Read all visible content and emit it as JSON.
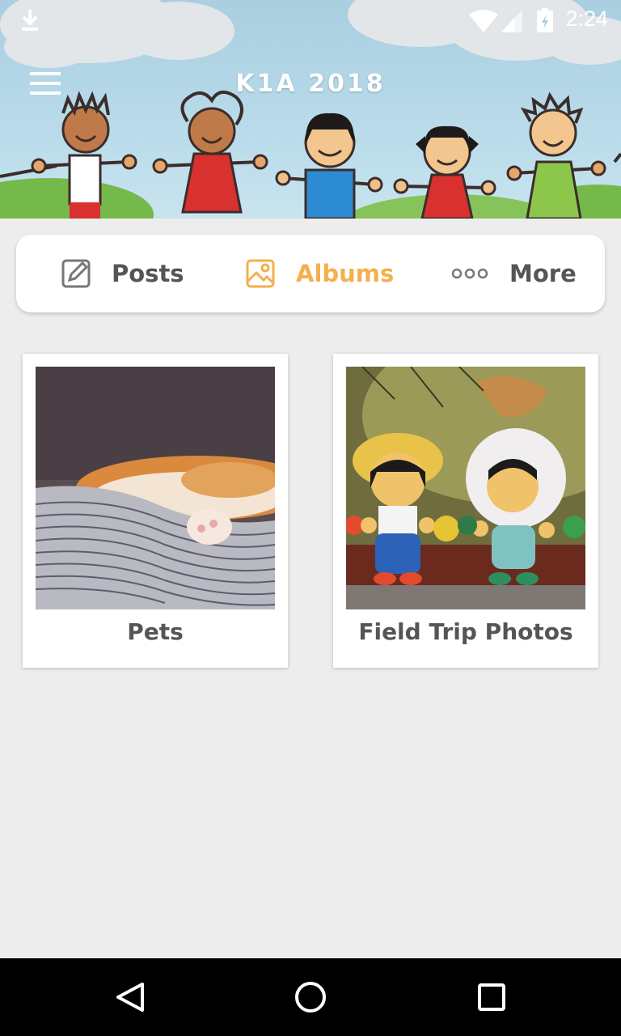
{
  "status_bar": {
    "time": "2:24",
    "icons": [
      "download-icon",
      "wifi-icon",
      "signal-icon",
      "battery-icon"
    ]
  },
  "header": {
    "title": "K1A 2018",
    "menu_icon": "hamburger-menu-icon"
  },
  "tabs": [
    {
      "label": "Posts",
      "icon": "edit-icon",
      "active": false
    },
    {
      "label": "Albums",
      "icon": "image-icon",
      "active": true
    },
    {
      "label": "More",
      "icon": "more-dots-icon",
      "active": false
    }
  ],
  "albums": [
    {
      "label": "Pets"
    },
    {
      "label": "Field Trip Photos"
    }
  ],
  "nav_bar": {
    "icons": [
      "back-icon",
      "home-icon",
      "recents-icon"
    ]
  },
  "colors": {
    "accent": "#f3b04d",
    "text": "#555555",
    "background": "#ededed"
  }
}
